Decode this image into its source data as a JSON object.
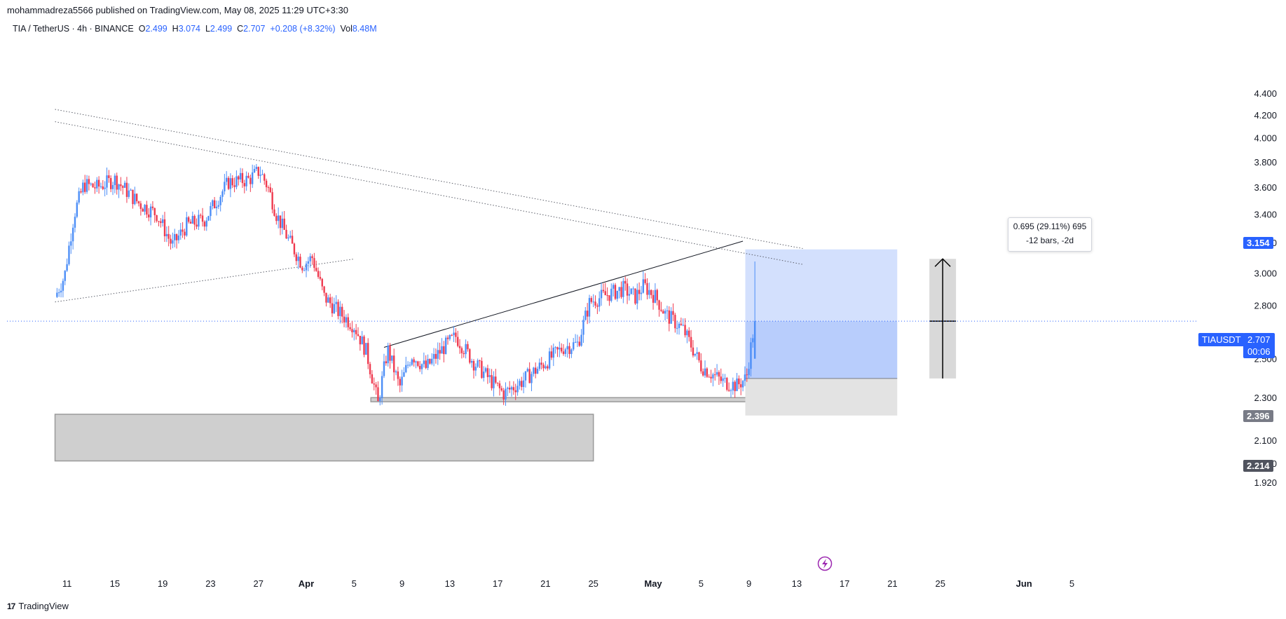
{
  "header": {
    "publisher_line": "mohammadreza5566 published on TradingView.com, May 08, 2025 11:29 UTC+3:30"
  },
  "legend": {
    "symbol": "TIA / TetherUS · 4h · BINANCE",
    "o_label": "O",
    "o_value": "2.499",
    "h_label": "H",
    "h_value": "3.074",
    "l_label": "L",
    "l_value": "2.499",
    "c_label": "C",
    "c_value": "2.707",
    "change": "+0.208 (+8.32%)",
    "vol_label": "Vol",
    "vol_value": "8.48M"
  },
  "measure_tooltip": {
    "line1": "0.695 (29.11%) 695",
    "line2": "-12 bars, -2d"
  },
  "price_badges": {
    "target": "3.154",
    "symbol": "TIAUSDT",
    "current": "2.707",
    "countdown": "00:06",
    "entry": "2.396",
    "stop": "2.214"
  },
  "footer": {
    "brand": "TradingView",
    "logo": "17"
  },
  "colors": {
    "up": "#4c8ef7",
    "down": "#ef3a4f",
    "accent": "#2962ff",
    "target_zone": "#b8cdfc",
    "stop_zone": "#d9d9d9",
    "zone_box": "#cfcfcf"
  },
  "chart_data": {
    "type": "candlestick",
    "symbol": "TIA / TetherUS",
    "interval": "4h",
    "exchange": "BINANCE",
    "y_ticks": [
      "4.400",
      "4.200",
      "4.000",
      "3.800",
      "3.600",
      "3.400",
      "3.200",
      "3.000",
      "2.800",
      "2.500",
      "2.300",
      "2.100",
      "2.000",
      "1.920"
    ],
    "y_tick_values": [
      4.4,
      4.2,
      4.0,
      3.8,
      3.6,
      3.4,
      3.2,
      3.0,
      2.8,
      2.5,
      2.3,
      2.1,
      2.0,
      1.92
    ],
    "x_ticks": [
      "11",
      "15",
      "19",
      "23",
      "27",
      "Apr",
      "5",
      "9",
      "13",
      "17",
      "21",
      "25",
      "May",
      "5",
      "9",
      "13",
      "17",
      "21",
      "25",
      "Jun",
      "5"
    ],
    "x_tick_days": [
      -20,
      -16,
      -12,
      -8,
      -4,
      0,
      4,
      8,
      12,
      16,
      20,
      24,
      29,
      33,
      37,
      41,
      45,
      49,
      53,
      60,
      64
    ],
    "y_scale": "log",
    "price_path": [
      {
        "day": -21,
        "price": 2.85
      },
      {
        "day": -20.2,
        "price": 2.98
      },
      {
        "day": -19.4,
        "price": 3.4
      },
      {
        "day": -18.6,
        "price": 3.62
      },
      {
        "day": -17.5,
        "price": 3.6
      },
      {
        "day": -16,
        "price": 3.66
      },
      {
        "day": -14,
        "price": 3.48
      },
      {
        "day": -12.5,
        "price": 3.4
      },
      {
        "day": -11.2,
        "price": 3.18
      },
      {
        "day": -10,
        "price": 3.32
      },
      {
        "day": -8.5,
        "price": 3.36
      },
      {
        "day": -6.5,
        "price": 3.64
      },
      {
        "day": -4.8,
        "price": 3.66
      },
      {
        "day": -3.9,
        "price": 3.73
      },
      {
        "day": -3.2,
        "price": 3.6
      },
      {
        "day": -2.5,
        "price": 3.4
      },
      {
        "day": -1.5,
        "price": 3.22
      },
      {
        "day": -0.3,
        "price": 3.05
      },
      {
        "day": 0.5,
        "price": 3.1
      },
      {
        "day": 1.5,
        "price": 2.85
      },
      {
        "day": 2.7,
        "price": 2.76
      },
      {
        "day": 4,
        "price": 2.68
      },
      {
        "day": 5,
        "price": 2.54
      },
      {
        "day": 6,
        "price": 2.27
      },
      {
        "day": 6.8,
        "price": 2.55
      },
      {
        "day": 7.8,
        "price": 2.35
      },
      {
        "day": 8.8,
        "price": 2.52
      },
      {
        "day": 10,
        "price": 2.45
      },
      {
        "day": 11.5,
        "price": 2.56
      },
      {
        "day": 12.5,
        "price": 2.62
      },
      {
        "day": 14,
        "price": 2.48
      },
      {
        "day": 15.5,
        "price": 2.38
      },
      {
        "day": 16.5,
        "price": 2.32
      },
      {
        "day": 18,
        "price": 2.38
      },
      {
        "day": 20,
        "price": 2.48
      },
      {
        "day": 21.5,
        "price": 2.56
      },
      {
        "day": 22.7,
        "price": 2.58
      },
      {
        "day": 23.7,
        "price": 2.82
      },
      {
        "day": 25,
        "price": 2.86
      },
      {
        "day": 26.5,
        "price": 2.9
      },
      {
        "day": 27.5,
        "price": 2.85
      },
      {
        "day": 28.2,
        "price": 2.92
      },
      {
        "day": 29.2,
        "price": 2.85
      },
      {
        "day": 30,
        "price": 2.75
      },
      {
        "day": 31.5,
        "price": 2.66
      },
      {
        "day": 33,
        "price": 2.46
      },
      {
        "day": 34.8,
        "price": 2.38
      },
      {
        "day": 36,
        "price": 2.36
      },
      {
        "day": 36.8,
        "price": 2.4
      },
      {
        "day": 37.5,
        "price": 2.707
      }
    ],
    "rectangles": [
      {
        "label": "lower support zone",
        "day_start": -21,
        "day_end": 24,
        "price_top": 2.22,
        "price_bottom": 2.01
      },
      {
        "label": "thin support zone",
        "day_start": 5.4,
        "day_end": 47,
        "price_top": 2.3,
        "price_bottom": 2.28
      }
    ],
    "long_position": {
      "day_start": 36.7,
      "day_end": 49.4,
      "target": 3.154,
      "entry": 2.396,
      "stop": 2.214,
      "current": 2.707
    },
    "measure": {
      "day": 53.2,
      "from": 2.396,
      "to": 3.091,
      "change": 0.695,
      "percent": 29.11,
      "bars": -12,
      "days": -2
    },
    "trendlines": [
      {
        "style": "dotted",
        "from": {
          "day": -21,
          "price": 4.25
        },
        "to": {
          "day": 41.5,
          "price": 3.16
        }
      },
      {
        "style": "dotted",
        "from": {
          "day": -21,
          "price": 4.14
        },
        "to": {
          "day": 41.5,
          "price": 3.055
        }
      },
      {
        "style": "dotted",
        "from": {
          "day": -21,
          "price": 2.82
        },
        "to": {
          "day": 4,
          "price": 3.09
        }
      },
      {
        "style": "solid",
        "from": {
          "day": 6.5,
          "price": 2.56
        },
        "to": {
          "day": 36.5,
          "price": 3.21
        }
      }
    ]
  }
}
